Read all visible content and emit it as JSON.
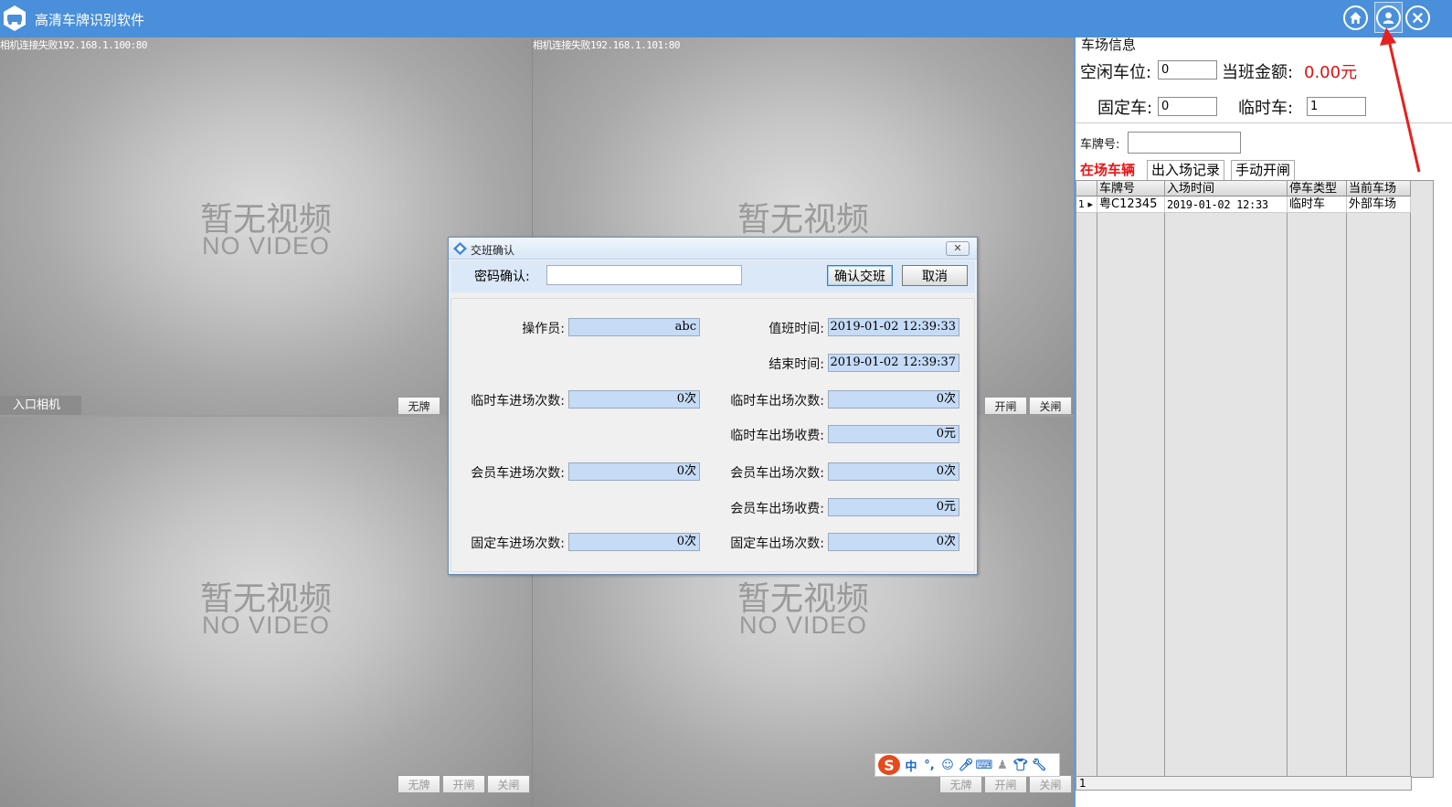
{
  "app": {
    "title": "高清车牌识别软件"
  },
  "titlebar_icons": [
    "home-icon",
    "user-icon",
    "close-icon"
  ],
  "cameras": [
    {
      "status": "相机连接失败192.168.1.100:80",
      "no_video_cn": "暂无视频",
      "no_video_en": "NO VIDEO"
    },
    {
      "status": "相机连接失败192.168.1.101:80",
      "no_video_cn": "暂无视频",
      "no_video_en": "NO VIDEO"
    },
    {
      "status": "",
      "no_video_cn": "暂无视频",
      "no_video_en": "NO VIDEO"
    },
    {
      "status": "",
      "no_video_cn": "暂无视频",
      "no_video_en": "NO VIDEO"
    }
  ],
  "entry_label": "入口相机",
  "cam_buttons": {
    "no_plate": "无牌",
    "open": "开闸",
    "close": "关闸"
  },
  "lot_info": {
    "title": "车场信息",
    "free_spaces_label": "空闲车位:",
    "free_spaces": "0",
    "shift_amount_label": "当班金额:",
    "shift_amount": "0.00元",
    "fixed_label": "固定车:",
    "fixed": "0",
    "temp_label": "临时车:",
    "temp": "1",
    "plate_label": "车牌号:",
    "plate": ""
  },
  "tabs": [
    "在场车辆",
    "出入场记录",
    "手动开闸"
  ],
  "grid": {
    "columns": [
      "车牌号",
      "入场时间",
      "停车类型",
      "当前车场"
    ],
    "rows": [
      {
        "index": "1",
        "plate": "粤C12345",
        "time": "2019-01-02 12:33",
        "type": "临时车",
        "lot": "外部车场"
      }
    ],
    "footer_count": "1"
  },
  "dialog": {
    "title": "交班确认",
    "password_label": "密码确认:",
    "password": "",
    "confirm": "确认交班",
    "cancel": "取消",
    "fields": {
      "operator_label": "操作员:",
      "operator": "abc",
      "duty_time_label": "值班时间:",
      "duty_time": "2019-01-02 12:39:33",
      "end_time_label": "结束时间:",
      "end_time": "2019-01-02 12:39:37",
      "temp_in_label": "临时车进场次数:",
      "temp_in": "0次",
      "temp_out_label": "临时车出场次数:",
      "temp_out": "0次",
      "temp_fee_label": "临时车出场收费:",
      "temp_fee": "0元",
      "member_in_label": "会员车进场次数:",
      "member_in": "0次",
      "member_out_label": "会员车出场次数:",
      "member_out": "0次",
      "member_fee_label": "会员车出场收费:",
      "member_fee": "0元",
      "fixed_in_label": "固定车进场次数:",
      "fixed_in": "0次",
      "fixed_out_label": "固定车出场次数:",
      "fixed_out": "0次"
    }
  },
  "ime": {
    "lang": "中",
    "punct": "°,"
  },
  "colors": {
    "titlebar": "#4a8fd9",
    "accent_red": "#e11111",
    "field_blue": "#c5dbf6"
  }
}
